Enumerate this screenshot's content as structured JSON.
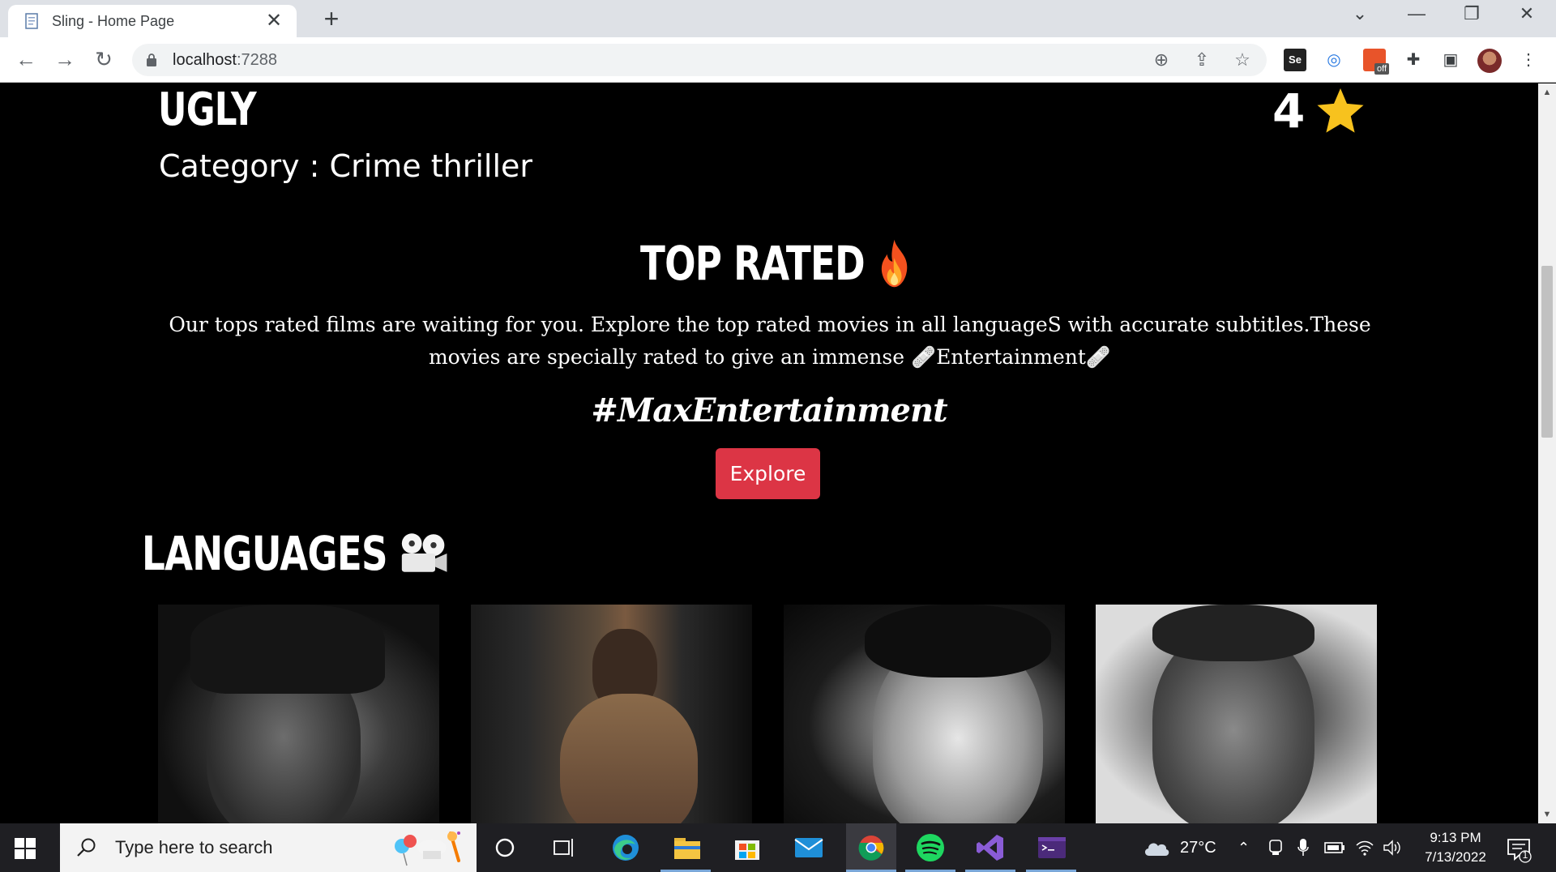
{
  "browser": {
    "tab_title": "Sling - Home Page",
    "url_host": "localhost",
    "url_port": ":7288",
    "extension_badge": "off",
    "extension_se_label": "Se"
  },
  "page": {
    "movie_title": "UGLY",
    "rating": "4",
    "category": "Category : Crime thriller",
    "top_rated_title": "TOP RATED",
    "description": "Our tops rated films are waiting for you. Explore the top rated movies in all languageS with accurate subtitles.These movies are specially rated to give an immense 🩹Entertainment🩹",
    "hashtag": "#MaxEntertainment",
    "explore_label": "Explore",
    "languages_title": "LANGUAGES",
    "language_cards": [
      "card-1",
      "card-2",
      "card-3",
      "card-4"
    ]
  },
  "taskbar": {
    "search_placeholder": "Type here to search",
    "temperature": "27°C",
    "time": "9:13 PM",
    "date": "7/13/2022",
    "notification_count": "1"
  },
  "colors": {
    "accent_button": "#dc3545",
    "star": "#f7c21e",
    "page_background": "#000000"
  }
}
